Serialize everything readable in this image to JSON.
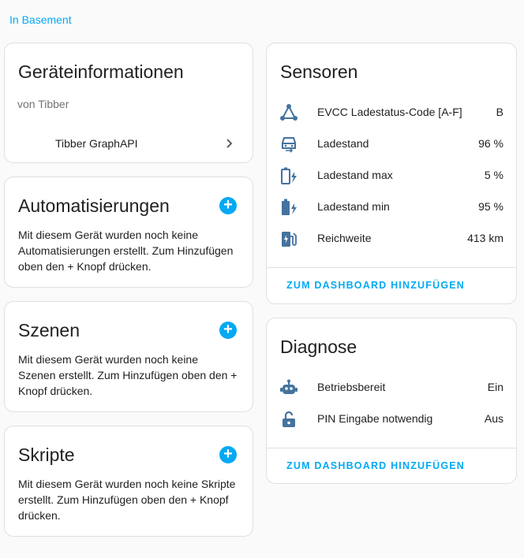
{
  "area_link": "In Basement",
  "device_info": {
    "title": "Geräteinformationen",
    "manufacturer": "von Tibber",
    "integration": "Tibber GraphAPI"
  },
  "automations": {
    "title": "Automatisierungen",
    "text": "Mit diesem Gerät wurden noch keine Automatisierungen erstellt. Zum Hinzufügen oben den + Knopf drücken."
  },
  "scenes": {
    "title": "Szenen",
    "text": "Mit diesem Gerät wurden noch keine Szenen erstellt. Zum Hinzufügen oben den + Knopf drücken."
  },
  "scripts": {
    "title": "Skripte",
    "text": "Mit diesem Gerät wurden noch keine Skripte erstellt. Zum Hinzufügen oben den + Knopf drücken."
  },
  "sensors": {
    "title": "Sensoren",
    "items": [
      {
        "name": "EVCC Ladestatus-Code [A-F]",
        "value": "B",
        "icon": "graph-icon"
      },
      {
        "name": "Ladestand",
        "value": "96 %",
        "icon": "car-icon"
      },
      {
        "name": "Ladestand max",
        "value": "5 %",
        "icon": "battery-charging-outline-icon"
      },
      {
        "name": "Ladestand min",
        "value": "95 %",
        "icon": "battery-charging-icon"
      },
      {
        "name": "Reichweite",
        "value": "413 km",
        "icon": "ev-station-icon"
      }
    ],
    "action": "ZUM DASHBOARD HINZUFÜGEN"
  },
  "diagnostics": {
    "title": "Diagnose",
    "items": [
      {
        "name": "Betriebsbereit",
        "value": "Ein",
        "icon": "robot-icon"
      },
      {
        "name": "PIN Eingabe notwendig",
        "value": "Aus",
        "icon": "lock-open-icon"
      }
    ],
    "action": "ZUM DASHBOARD HINZUFÜGEN"
  },
  "colors": {
    "accent": "#03a9f4",
    "icon": "#44739e"
  }
}
